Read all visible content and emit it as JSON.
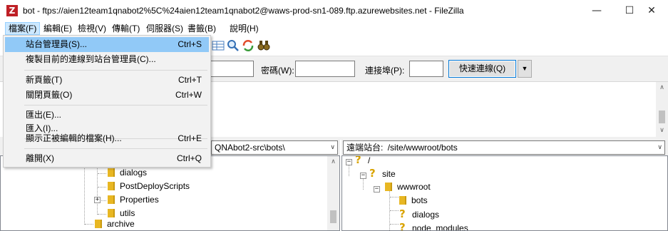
{
  "window": {
    "title": "bot - ftps://aien12team1qnabot2%5C%24aien12team1qnabot2@waws-prod-sn1-089.ftp.azurewebsites.net - FileZilla",
    "app_icon": "Z",
    "minimize": "—",
    "maximize": "☐",
    "close": "✕"
  },
  "menubar": [
    {
      "label": "檔案(F)"
    },
    {
      "label": "編輯(E)"
    },
    {
      "label": "檢視(V)"
    },
    {
      "label": "傳輸(T)"
    },
    {
      "label": "伺服器(S)"
    },
    {
      "label": "書籤(B)"
    },
    {
      "label": "說明(H)"
    }
  ],
  "file_menu": [
    {
      "label": "站台管理員(S)...",
      "accel": "Ctrl+S"
    },
    {
      "label": "複製目前的連線到站台管理員(C)...",
      "accel": ""
    },
    {
      "label": "新頁籤(T)",
      "accel": "Ctrl+T"
    },
    {
      "label": "關閉頁籤(O)",
      "accel": "Ctrl+W"
    },
    {
      "label": "匯出(E)...",
      "accel": ""
    },
    {
      "label": "匯入(I)...",
      "accel": ""
    },
    {
      "label": "顯示正被編輯的檔案(H)...",
      "accel": "Ctrl+E"
    },
    {
      "label": "離開(X)",
      "accel": "Ctrl+Q"
    }
  ],
  "quickconnect": {
    "password_label": "密碼(W):",
    "password_value": "",
    "port_label": "連接埠(P):",
    "port_value": "",
    "connect_button": "快速連線(Q)",
    "dropdown_arrow": "▼"
  },
  "local": {
    "path": "QNAbot2-src\\bots\\",
    "tree": [
      {
        "name": "dialogs"
      },
      {
        "name": "PostDeployScripts"
      },
      {
        "name": "Properties"
      },
      {
        "name": "utils"
      },
      {
        "name": "archive"
      }
    ]
  },
  "remote": {
    "path_label": "遠端站台:",
    "path": "/site/wwwroot/bots",
    "tree": [
      {
        "name": "/"
      },
      {
        "name": "site"
      },
      {
        "name": "wwwroot"
      },
      {
        "name": "bots"
      },
      {
        "name": "dialogs"
      },
      {
        "name": "node_modules"
      }
    ]
  },
  "colors": {
    "highlight": "#91c9f7",
    "menu_active": "#cce8ff",
    "folder": "#e8b723",
    "app_icon": "#bf2026"
  }
}
